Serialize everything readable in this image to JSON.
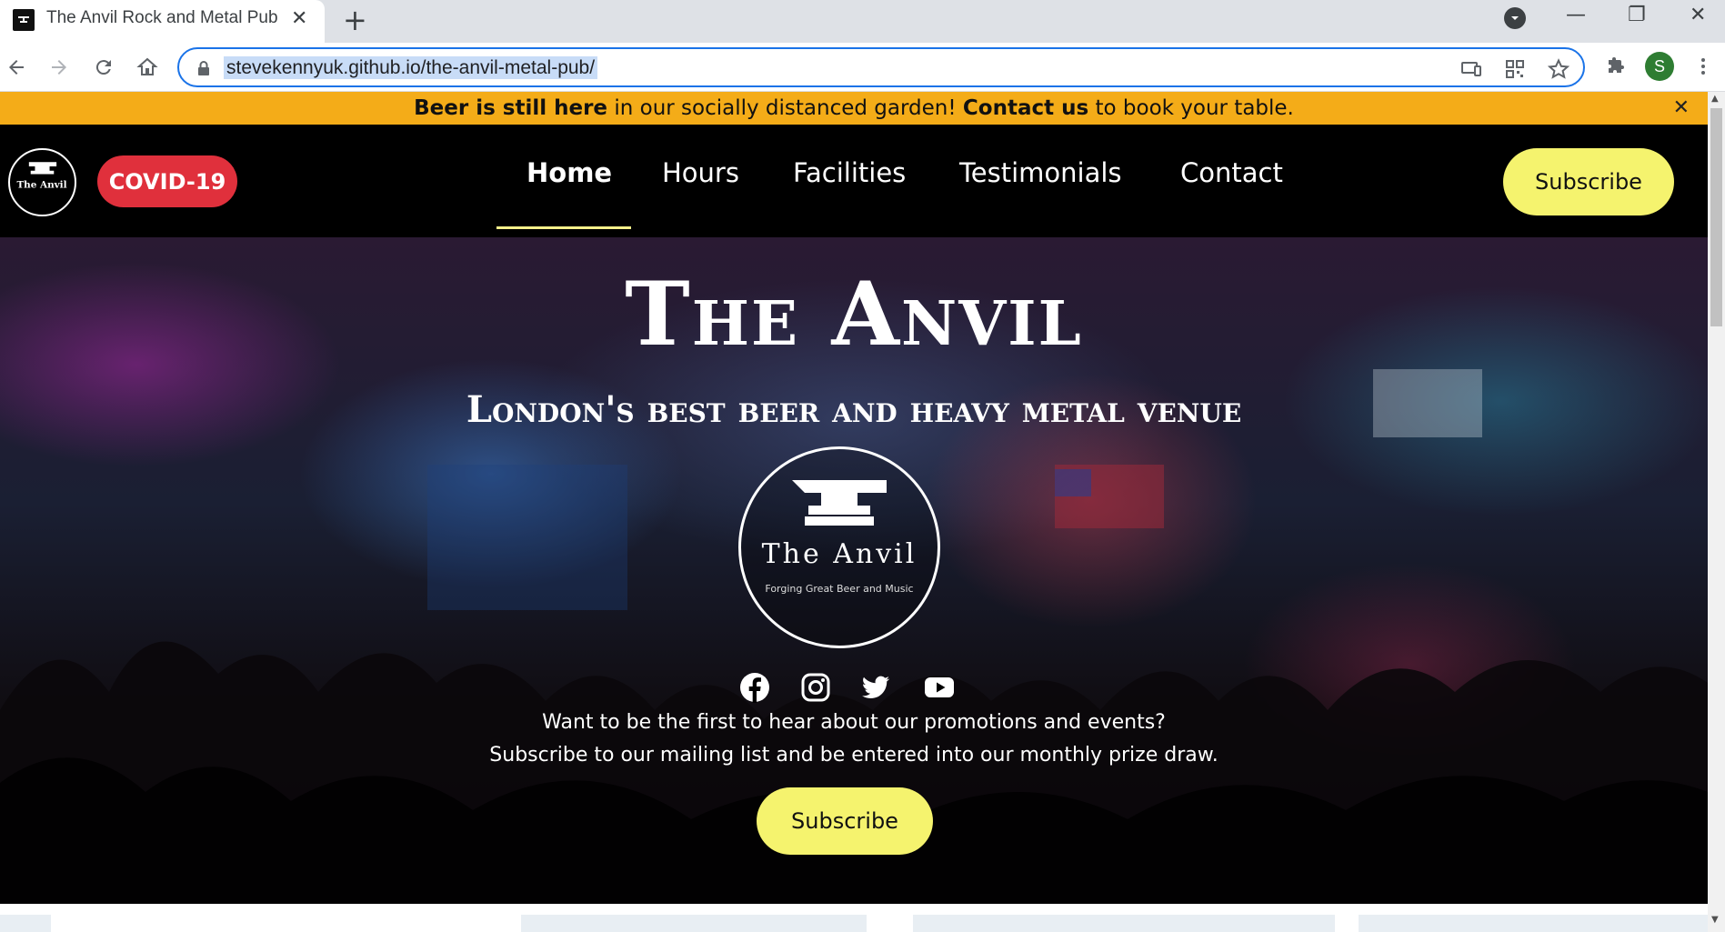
{
  "browser": {
    "tab_title": "The Anvil Rock and Metal Pub",
    "tab_close": "✕",
    "new_tab": "+",
    "url": "stevekennyuk.github.io/the-anvil-metal-pub/",
    "profile_initial": "S",
    "window_controls": [
      "—",
      "❐",
      "✕"
    ]
  },
  "announcement": {
    "bold1": "Beer is still here",
    "text1": " in our socially distanced garden! ",
    "bold2": "Contact us",
    "text2": " to book your table.",
    "close": "✕"
  },
  "navbar": {
    "covid_label": "COVID-19",
    "links": [
      "Home",
      "Hours",
      "Facilities",
      "Testimonials",
      "Contact"
    ],
    "active": "Home",
    "subscribe_label": "Subscribe"
  },
  "hero": {
    "title": "The Anvil",
    "subtitle": "London's best beer and heavy metal venue",
    "logo_text": "The Anvil",
    "logo_tagline": "Forging Great Beer and Music",
    "social": [
      "facebook-icon",
      "instagram-icon",
      "twitter-icon",
      "youtube-icon"
    ],
    "promo_line1": "Want to be the first to hear about our promotions and events?",
    "promo_line2": "Subscribe to our mailing list and be entered into our monthly prize draw.",
    "subscribe_label": "Subscribe"
  },
  "colors": {
    "announcement_bg": "#f4ac18",
    "covid_bg": "#e0303c",
    "subscribe_bg": "#f5f36e",
    "nav_underline": "#f6f08a"
  }
}
